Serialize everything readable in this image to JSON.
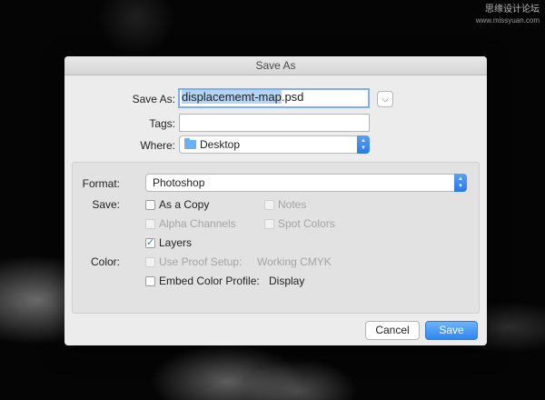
{
  "watermark": {
    "text": "思缘设计论坛",
    "url": "www.missyuan.com"
  },
  "dialog": {
    "title": "Save As",
    "save_as": {
      "label": "Save As:",
      "value_selected": "displacememt-map",
      "value_ext": ".psd",
      "expand_icon": "chevron-down-icon"
    },
    "tags": {
      "label": "Tags:",
      "value": ""
    },
    "where": {
      "label": "Where:",
      "value": "Desktop",
      "icon": "folder-icon"
    },
    "format": {
      "label": "Format:",
      "value": "Photoshop"
    },
    "save_options": {
      "label": "Save:",
      "items": [
        {
          "label": "As a Copy",
          "checked": false,
          "enabled": true
        },
        {
          "label": "Notes",
          "checked": false,
          "enabled": false
        },
        {
          "label": "Alpha Channels",
          "checked": false,
          "enabled": false
        },
        {
          "label": "Spot Colors",
          "checked": false,
          "enabled": false
        },
        {
          "label": "Layers",
          "checked": true,
          "enabled": true
        }
      ]
    },
    "color_options": {
      "label": "Color:",
      "proof_setup": {
        "label": "Use Proof Setup:",
        "value": "Working CMYK",
        "checked": false,
        "enabled": false
      },
      "embed_profile": {
        "label": "Embed Color Profile:",
        "value": "Display",
        "checked": false,
        "enabled": true
      }
    },
    "buttons": {
      "cancel": "Cancel",
      "save": "Save"
    },
    "accent_color": "#2f86ef"
  }
}
